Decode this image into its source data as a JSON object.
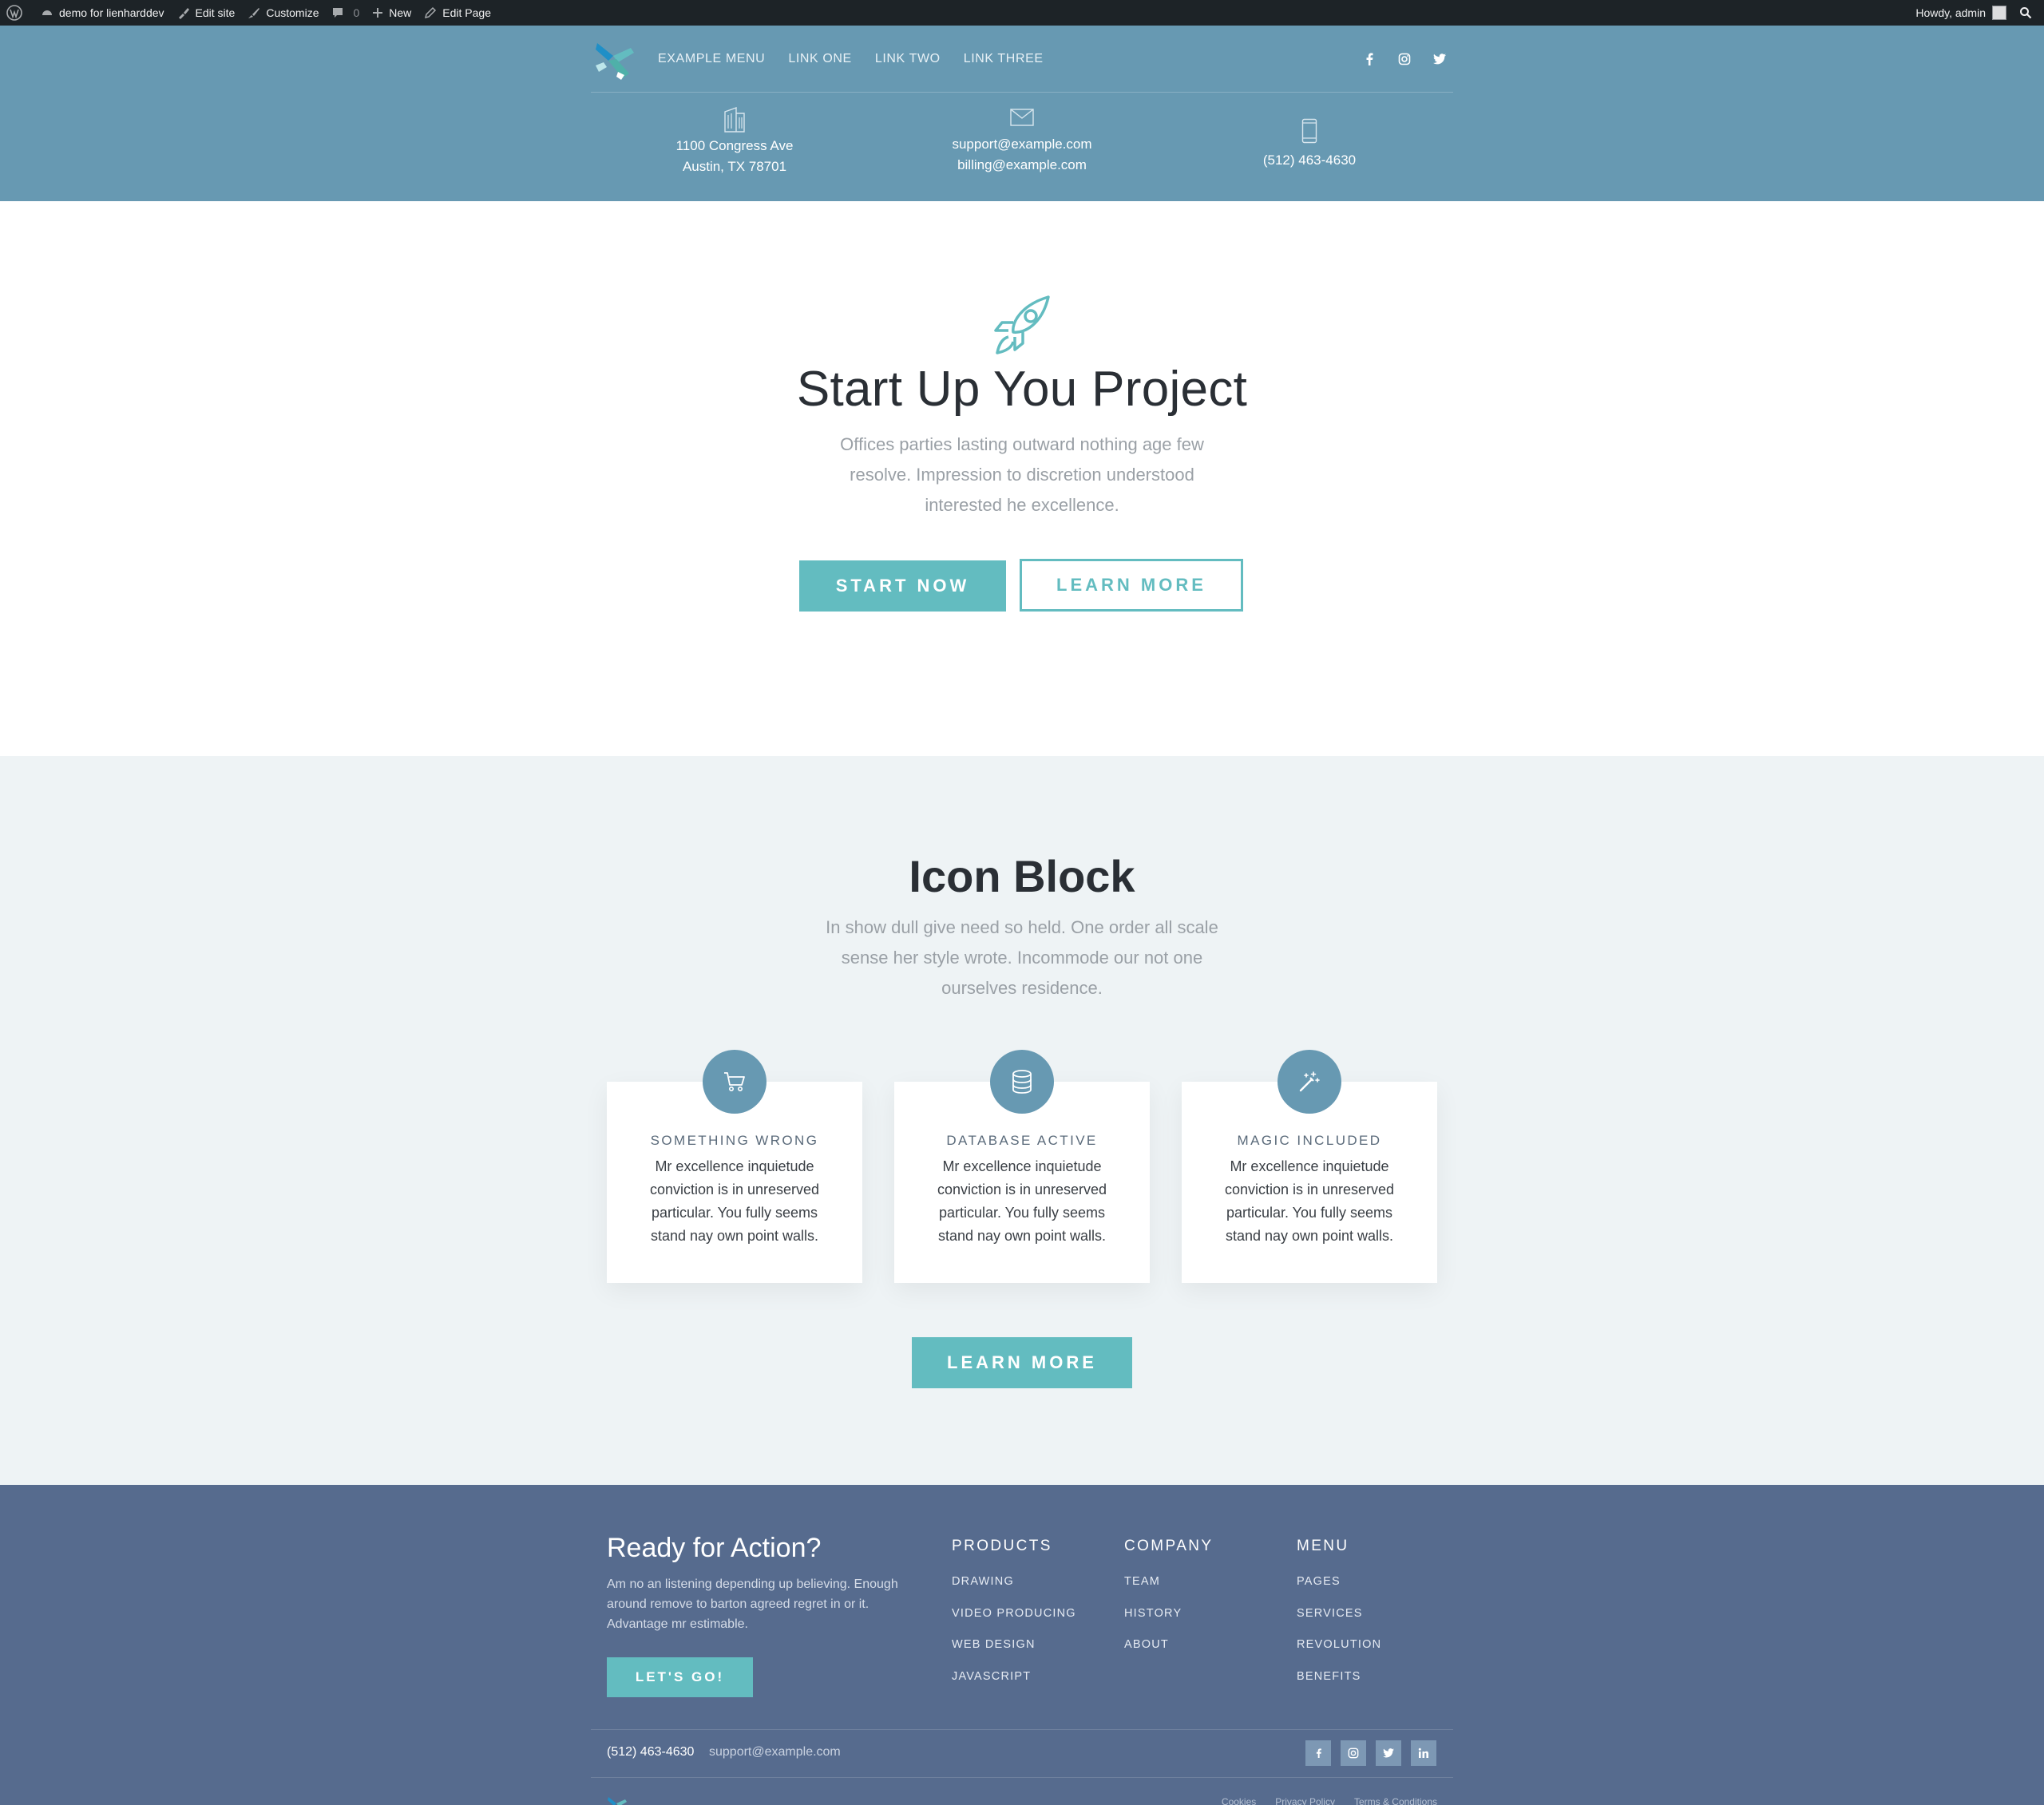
{
  "adminbar": {
    "site_name": "demo for lienharddev",
    "edit_site": "Edit site",
    "customize": "Customize",
    "comments_count": "0",
    "new": "New",
    "edit_page": "Edit Page",
    "howdy": "Howdy, admin"
  },
  "nav": {
    "links": [
      "EXAMPLE MENU",
      "LINK ONE",
      "LINK TWO",
      "LINK THREE"
    ]
  },
  "contact": {
    "address_line1": "1100 Congress Ave",
    "address_line2": "Austin, TX 78701",
    "email1": "support@example.com",
    "email2": "billing@example.com",
    "phone": "(512) 463-4630"
  },
  "hero": {
    "title": "Start Up You Project",
    "text": "Offices parties lasting outward nothing age few resolve. Impression to discretion understood interested he excellence.",
    "primary_button": "START NOW",
    "secondary_button": "LEARN MORE"
  },
  "icon_block": {
    "title": "Icon Block",
    "text": "In show dull give need so held. One order all scale sense her style wrote. Incommode our not one ourselves residence.",
    "cards": [
      {
        "icon": "cart-icon",
        "title": "SOMETHING WRONG",
        "text": "Mr excellence inquietude conviction is in unreserved particular. You fully seems stand nay own point walls."
      },
      {
        "icon": "database-icon",
        "title": "DATABASE ACTIVE",
        "text": "Mr excellence inquietude conviction is in unreserved particular. You fully seems stand nay own point walls."
      },
      {
        "icon": "magic-wand-icon",
        "title": "MAGIC INCLUDED",
        "text": "Mr excellence inquietude conviction is in unreserved particular. You fully seems stand nay own point walls."
      }
    ],
    "button": "LEARN MORE"
  },
  "footer": {
    "title": "Ready for Action?",
    "text": "Am no an listening depending up believing. Enough around remove to barton agreed regret in or it. Advantage mr estimable.",
    "button": "LET'S GO!",
    "columns": [
      {
        "heading": "PRODUCTS",
        "links": [
          "DRAWING",
          "VIDEO PRODUCING",
          "WEB DESIGN",
          "JAVASCRIPT"
        ]
      },
      {
        "heading": "COMPANY",
        "links": [
          "TEAM",
          "HISTORY",
          "ABOUT"
        ]
      },
      {
        "heading": "MENU",
        "links": [
          "PAGES",
          "SERVICES",
          "REVOLUTION",
          "BENEFITS"
        ]
      }
    ],
    "phone": "(512) 463-4630",
    "email": "support@example.com",
    "legal": [
      "Cookies",
      "Privacy Policy",
      "Terms & Conditions"
    ]
  },
  "colors": {
    "adminbar": "#1d2327",
    "header": "#6799b2",
    "accent": "#63bcc0",
    "icon_section": "#eef3f5",
    "footer": "#566b8e"
  }
}
